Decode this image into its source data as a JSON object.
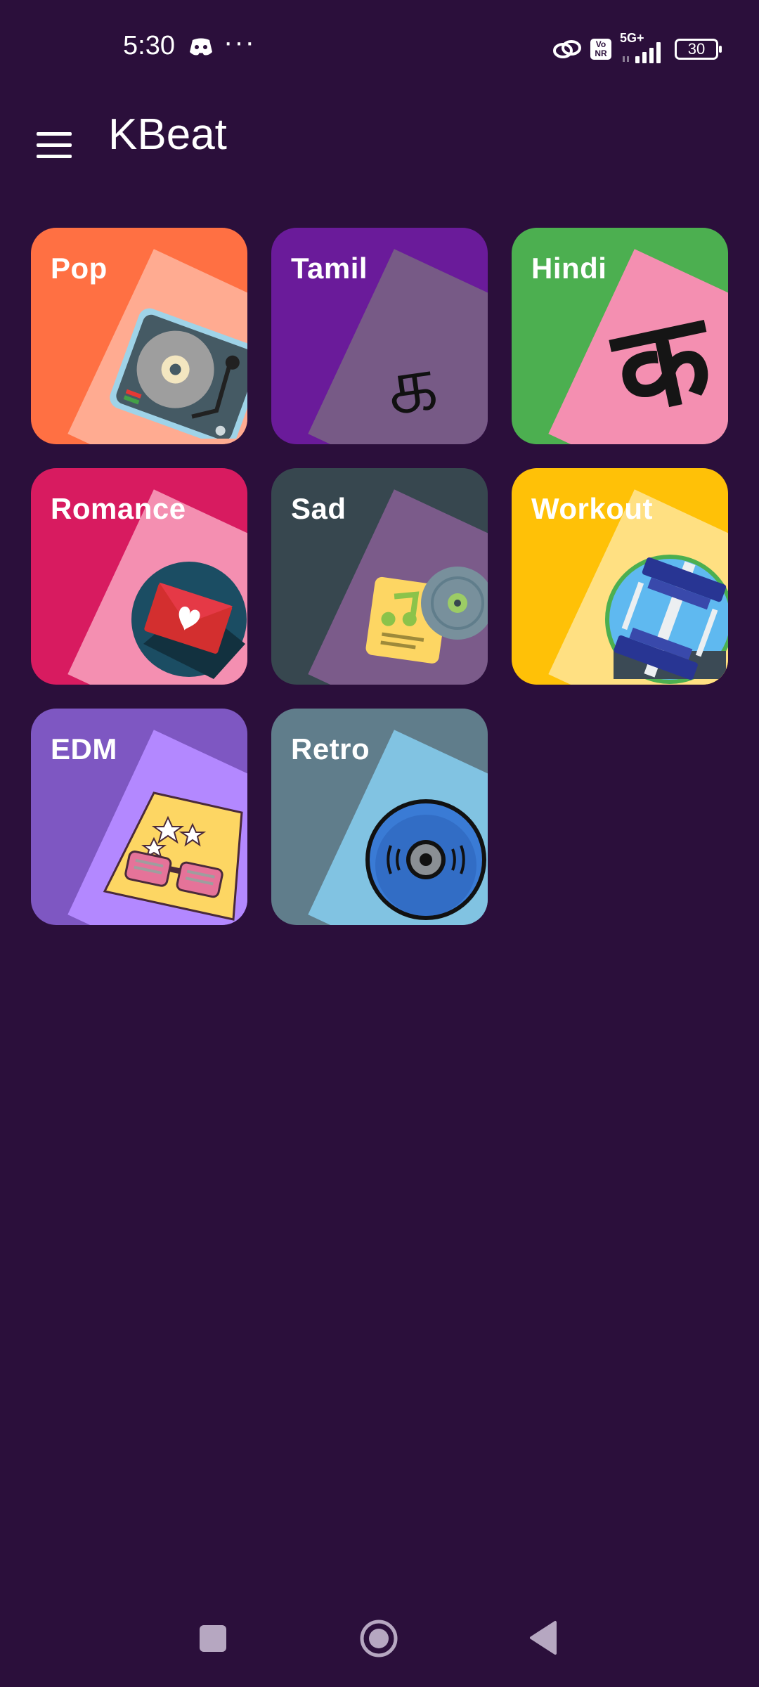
{
  "status_bar": {
    "time": "5:30",
    "dots": "···",
    "volte": "Vo\nNR",
    "network": "5G+",
    "battery": "30"
  },
  "app_bar": {
    "title": "KBeat",
    "menu_icon": "hamburger-menu-icon"
  },
  "genres": [
    {
      "label": "Pop",
      "color": "#ff7043",
      "card": "#ffab91",
      "icon": "turntable-icon"
    },
    {
      "label": "Tamil",
      "color": "#6a1b9a",
      "card": "#775a86",
      "icon": "tamil-letter-icon",
      "glyph": "க"
    },
    {
      "label": "Hindi",
      "color": "#4caf50",
      "card": "#f48fb1",
      "icon": "hindi-letter-icon",
      "glyph": "क"
    },
    {
      "label": "Romance",
      "color": "#d81b60",
      "card": "#f48fb1",
      "icon": "love-letter-icon"
    },
    {
      "label": "Sad",
      "color": "#37474f",
      "card": "#7b5b8a",
      "icon": "music-note-vinyl-icon"
    },
    {
      "label": "Workout",
      "color": "#ffc107",
      "card": "#ffe082",
      "icon": "dumbbell-icon"
    },
    {
      "label": "EDM",
      "color": "#7e57c2",
      "card": "#b388ff",
      "icon": "party-glasses-icon"
    },
    {
      "label": "Retro",
      "color": "#607d8b",
      "card": "#81c3e2",
      "icon": "vinyl-record-icon"
    }
  ],
  "nav_bar": {
    "recents_icon": "square-recents-icon",
    "home_icon": "circle-home-icon",
    "back_icon": "triangle-back-icon"
  }
}
